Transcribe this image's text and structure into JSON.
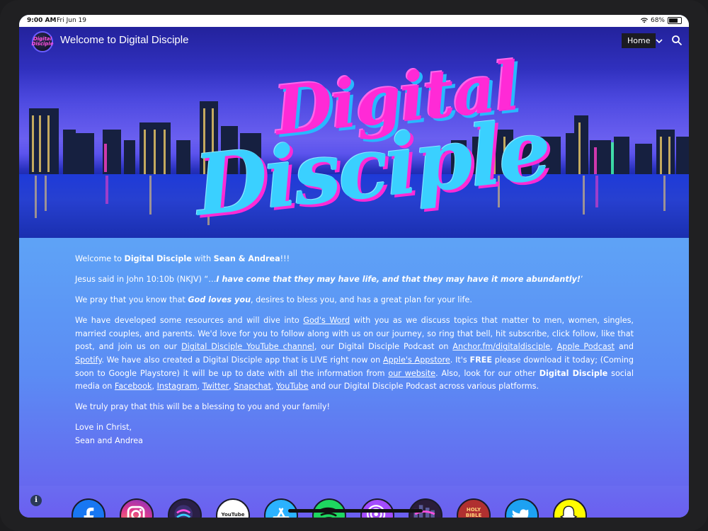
{
  "status_bar": {
    "time": "9:00 AM",
    "date": "Fri Jun 19",
    "battery": "68%"
  },
  "header": {
    "site_title": "Welcome to Digital Disciple",
    "nav_current": "Home",
    "logo_text": "Digital Disciple"
  },
  "hero": {
    "line1": "Digital",
    "line2": "Disciple"
  },
  "content": {
    "p1": {
      "a": "Welcome to ",
      "b": "Digital Disciple",
      "c": " with ",
      "d": "Sean & Andrea",
      "e": "!!!"
    },
    "p2": {
      "a": "Jesus said in John 10:10b (NKJV) “…",
      "b": "I have come that they may have life, and that they may have it more abundantly!",
      "c": "’"
    },
    "p3": {
      "a": "We pray that you know that ",
      "b": "God loves you",
      "c": ", desires to bless you, and has a great plan for your life."
    },
    "p4": {
      "t1": "We have developed some resources and will dive into ",
      "l_gods_word": "God's Word",
      "t2": " with you as we discuss topics that matter to men, women, singles, married couples, and parents. We'd love for you to follow along with us on our journey, so ring that bell, hit subscribe, click follow, like that post, and join us on our ",
      "l_youtube_channel": "Digital Disciple YouTube channel",
      "t3": ", our Digital Disciple Podcast on ",
      "l_anchor": "Anchor.fm/digitaldisciple",
      "t4": ", ",
      "l_apple_podcast": "Apple Podcast",
      "t5": " and ",
      "l_spotify": "Spotify",
      "t6": ". We have also created a Digital Disciple app that is LIVE right now on ",
      "l_appstore": "Apple's Appstore",
      "t7": ". It's ",
      "b_free": "FREE",
      "t8": " please download it today; (Coming soon to Google Playstore) it will be up to date with all the information from ",
      "l_website": "our website",
      "t9": ". Also, look for our other ",
      "b_dd": "Digital Disciple",
      "t10": " social media on ",
      "l_facebook": "Facebook",
      "t11": ", ",
      "l_instagram": "Instagram",
      "t12": ", ",
      "l_twitter": "Twitter",
      "t13": ", ",
      "l_snapchat": "Snapchat",
      "t14": ", ",
      "l_youtube": "YouTube",
      "t15": " and our Digital Disciple Podcast across various platforms."
    },
    "p5": "We truly pray that this will be a blessing to you and your family!",
    "p6_line1": "Love in Christ,",
    "p6_line2": "Sean and Andrea"
  },
  "footer": {
    "info": "i",
    "youtube_label": "YouTube",
    "bible_label": "HOLY BIBLE",
    "social_icons": [
      "facebook-icon",
      "instagram-icon",
      "digital-disciple-icon",
      "youtube-icon",
      "app-store-icon",
      "spotify-icon",
      "podcast-icon",
      "digital-disciple-alt-icon",
      "holy-bible-icon",
      "twitter-icon",
      "snapchat-icon"
    ]
  },
  "colors": {
    "hero_top": "#23229c",
    "content_bg": "#5b8cf4",
    "logo_pink": "#ff2ad6",
    "logo_cyan": "#3ad0ff"
  }
}
